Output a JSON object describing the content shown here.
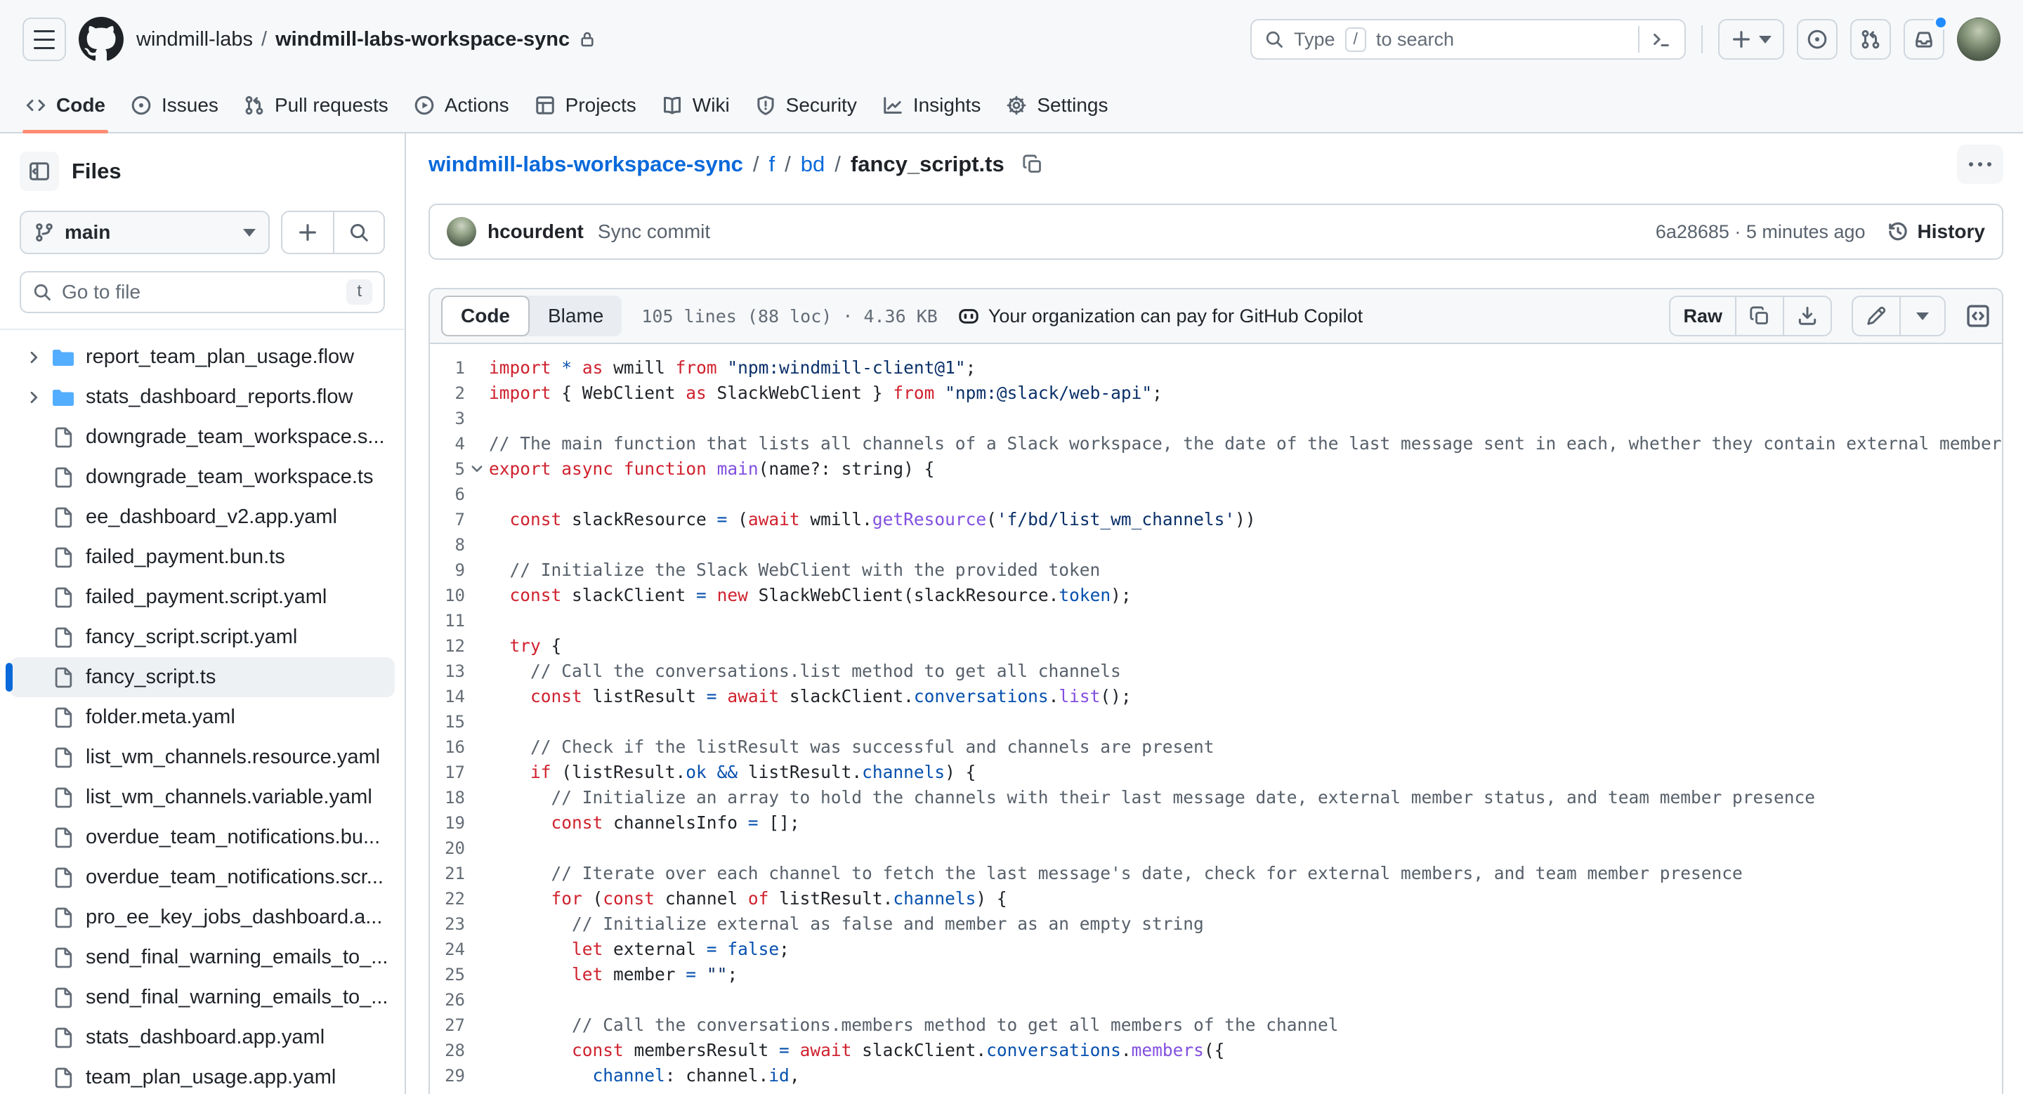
{
  "header": {
    "owner": "windmill-labs",
    "separator": "/",
    "repo": "windmill-labs-workspace-sync",
    "search": {
      "prefix": "Type",
      "kbd": "/",
      "suffix": "to search"
    }
  },
  "nav": {
    "tabs": [
      {
        "label": "Code",
        "active": true
      },
      {
        "label": "Issues",
        "active": false
      },
      {
        "label": "Pull requests",
        "active": false
      },
      {
        "label": "Actions",
        "active": false
      },
      {
        "label": "Projects",
        "active": false
      },
      {
        "label": "Wiki",
        "active": false
      },
      {
        "label": "Security",
        "active": false
      },
      {
        "label": "Insights",
        "active": false
      },
      {
        "label": "Settings",
        "active": false
      }
    ]
  },
  "sidebar": {
    "title": "Files",
    "branch": "main",
    "goto_placeholder": "Go to file",
    "goto_kbd": "t",
    "tree": [
      {
        "name": "report_team_plan_usage.flow",
        "type": "folder",
        "selected": false
      },
      {
        "name": "stats_dashboard_reports.flow",
        "type": "folder",
        "selected": false
      },
      {
        "name": "downgrade_team_workspace.s...",
        "type": "file",
        "selected": false
      },
      {
        "name": "downgrade_team_workspace.ts",
        "type": "file",
        "selected": false
      },
      {
        "name": "ee_dashboard_v2.app.yaml",
        "type": "file",
        "selected": false
      },
      {
        "name": "failed_payment.bun.ts",
        "type": "file",
        "selected": false
      },
      {
        "name": "failed_payment.script.yaml",
        "type": "file",
        "selected": false
      },
      {
        "name": "fancy_script.script.yaml",
        "type": "file",
        "selected": false
      },
      {
        "name": "fancy_script.ts",
        "type": "file",
        "selected": true
      },
      {
        "name": "folder.meta.yaml",
        "type": "file",
        "selected": false
      },
      {
        "name": "list_wm_channels.resource.yaml",
        "type": "file",
        "selected": false
      },
      {
        "name": "list_wm_channels.variable.yaml",
        "type": "file",
        "selected": false
      },
      {
        "name": "overdue_team_notifications.bu...",
        "type": "file",
        "selected": false
      },
      {
        "name": "overdue_team_notifications.scr...",
        "type": "file",
        "selected": false
      },
      {
        "name": "pro_ee_key_jobs_dashboard.a...",
        "type": "file",
        "selected": false
      },
      {
        "name": "send_final_warning_emails_to_...",
        "type": "file",
        "selected": false
      },
      {
        "name": "send_final_warning_emails_to_...",
        "type": "file",
        "selected": false
      },
      {
        "name": "stats_dashboard.app.yaml",
        "type": "file",
        "selected": false
      },
      {
        "name": "team_plan_usage.app.yaml",
        "type": "file",
        "selected": false
      }
    ]
  },
  "main": {
    "breadcrumb": {
      "repo": "windmill-labs-workspace-sync",
      "sep": "/",
      "dir1": "f",
      "dir2": "bd",
      "file": "fancy_script.ts"
    },
    "commit": {
      "author": "hcourdent",
      "message": "Sync commit",
      "meta": "6a28685 · 5 minutes ago",
      "history_label": "History"
    },
    "toolbar": {
      "code_tab": "Code",
      "blame_tab": "Blame",
      "file_info": "105 lines (88 loc) · 4.36 KB",
      "copilot_banner": "Your organization can pay for GitHub Copilot",
      "raw_label": "Raw"
    }
  },
  "code": {
    "accent_colors": {
      "keyword": "#cf222e",
      "constant": "#0550ae",
      "entity": "#8250df",
      "string": "#0a3069",
      "comment": "#57606a"
    },
    "lines": [
      {
        "n": 1,
        "t": [
          [
            "k",
            "import"
          ],
          [
            "p",
            " "
          ],
          [
            "b",
            "*"
          ],
          [
            "p",
            " "
          ],
          [
            "k",
            "as"
          ],
          [
            "p",
            " wmill "
          ],
          [
            "k",
            "from"
          ],
          [
            "p",
            " "
          ],
          [
            "s",
            "\"npm:windmill-client@1\""
          ],
          [
            "p",
            ";"
          ]
        ]
      },
      {
        "n": 2,
        "t": [
          [
            "k",
            "import"
          ],
          [
            "p",
            " { WebClient "
          ],
          [
            "k",
            "as"
          ],
          [
            "p",
            " SlackWebClient } "
          ],
          [
            "k",
            "from"
          ],
          [
            "p",
            " "
          ],
          [
            "s",
            "\"npm:@slack/web-api\""
          ],
          [
            "p",
            ";"
          ]
        ]
      },
      {
        "n": 3,
        "t": []
      },
      {
        "n": 4,
        "t": [
          [
            "c",
            "// The main function that lists all channels of a Slack workspace, the date of the last message sent in each, whether they contain external members, and if a sp"
          ]
        ]
      },
      {
        "n": 5,
        "fold": true,
        "t": [
          [
            "k",
            "export"
          ],
          [
            "p",
            " "
          ],
          [
            "k",
            "async"
          ],
          [
            "p",
            " "
          ],
          [
            "k",
            "function"
          ],
          [
            "p",
            " "
          ],
          [
            "e",
            "main"
          ],
          [
            "p",
            "(name?: string) {"
          ]
        ]
      },
      {
        "n": 6,
        "t": []
      },
      {
        "n": 7,
        "t": [
          [
            "p",
            "  "
          ],
          [
            "k",
            "const"
          ],
          [
            "p",
            " slackResource "
          ],
          [
            "b",
            "="
          ],
          [
            "p",
            " ("
          ],
          [
            "k",
            "await"
          ],
          [
            "p",
            " wmill."
          ],
          [
            "e",
            "getResource"
          ],
          [
            "p",
            "("
          ],
          [
            "s",
            "'f/bd/list_wm_channels'"
          ],
          [
            "p",
            "))"
          ]
        ]
      },
      {
        "n": 8,
        "t": []
      },
      {
        "n": 9,
        "t": [
          [
            "p",
            "  "
          ],
          [
            "c",
            "// Initialize the Slack WebClient with the provided token"
          ]
        ]
      },
      {
        "n": 10,
        "t": [
          [
            "p",
            "  "
          ],
          [
            "k",
            "const"
          ],
          [
            "p",
            " slackClient "
          ],
          [
            "b",
            "="
          ],
          [
            "p",
            " "
          ],
          [
            "k",
            "new"
          ],
          [
            "p",
            " SlackWebClient(slackResource."
          ],
          [
            "b",
            "token"
          ],
          [
            "p",
            ");"
          ]
        ]
      },
      {
        "n": 11,
        "t": []
      },
      {
        "n": 12,
        "t": [
          [
            "p",
            "  "
          ],
          [
            "k",
            "try"
          ],
          [
            "p",
            " {"
          ]
        ]
      },
      {
        "n": 13,
        "t": [
          [
            "p",
            "    "
          ],
          [
            "c",
            "// Call the conversations.list method to get all channels"
          ]
        ]
      },
      {
        "n": 14,
        "t": [
          [
            "p",
            "    "
          ],
          [
            "k",
            "const"
          ],
          [
            "p",
            " listResult "
          ],
          [
            "b",
            "="
          ],
          [
            "p",
            " "
          ],
          [
            "k",
            "await"
          ],
          [
            "p",
            " slackClient."
          ],
          [
            "b",
            "conversations"
          ],
          [
            "p",
            "."
          ],
          [
            "e",
            "list"
          ],
          [
            "p",
            "();"
          ]
        ]
      },
      {
        "n": 15,
        "t": []
      },
      {
        "n": 16,
        "t": [
          [
            "p",
            "    "
          ],
          [
            "c",
            "// Check if the listResult was successful and channels are present"
          ]
        ]
      },
      {
        "n": 17,
        "t": [
          [
            "p",
            "    "
          ],
          [
            "k",
            "if"
          ],
          [
            "p",
            " (listResult."
          ],
          [
            "b",
            "ok"
          ],
          [
            "p",
            " "
          ],
          [
            "b",
            "&&"
          ],
          [
            "p",
            " listResult."
          ],
          [
            "b",
            "channels"
          ],
          [
            "p",
            ") {"
          ]
        ]
      },
      {
        "n": 18,
        "t": [
          [
            "p",
            "      "
          ],
          [
            "c",
            "// Initialize an array to hold the channels with their last message date, external member status, and team member presence"
          ]
        ]
      },
      {
        "n": 19,
        "t": [
          [
            "p",
            "      "
          ],
          [
            "k",
            "const"
          ],
          [
            "p",
            " channelsInfo "
          ],
          [
            "b",
            "="
          ],
          [
            "p",
            " [];"
          ]
        ]
      },
      {
        "n": 20,
        "t": []
      },
      {
        "n": 21,
        "t": [
          [
            "p",
            "      "
          ],
          [
            "c",
            "// Iterate over each channel to fetch the last message's date, check for external members, and team member presence"
          ]
        ]
      },
      {
        "n": 22,
        "t": [
          [
            "p",
            "      "
          ],
          [
            "k",
            "for"
          ],
          [
            "p",
            " ("
          ],
          [
            "k",
            "const"
          ],
          [
            "p",
            " channel "
          ],
          [
            "k",
            "of"
          ],
          [
            "p",
            " listResult."
          ],
          [
            "b",
            "channels"
          ],
          [
            "p",
            ") {"
          ]
        ]
      },
      {
        "n": 23,
        "t": [
          [
            "p",
            "        "
          ],
          [
            "c",
            "// Initialize external as false and member as an empty string"
          ]
        ]
      },
      {
        "n": 24,
        "t": [
          [
            "p",
            "        "
          ],
          [
            "k",
            "let"
          ],
          [
            "p",
            " external "
          ],
          [
            "b",
            "="
          ],
          [
            "p",
            " "
          ],
          [
            "b",
            "false"
          ],
          [
            "p",
            ";"
          ]
        ]
      },
      {
        "n": 25,
        "t": [
          [
            "p",
            "        "
          ],
          [
            "k",
            "let"
          ],
          [
            "p",
            " member "
          ],
          [
            "b",
            "="
          ],
          [
            "p",
            " "
          ],
          [
            "s",
            "\"\""
          ],
          [
            "p",
            ";"
          ]
        ]
      },
      {
        "n": 26,
        "t": []
      },
      {
        "n": 27,
        "t": [
          [
            "p",
            "        "
          ],
          [
            "c",
            "// Call the conversations.members method to get all members of the channel"
          ]
        ]
      },
      {
        "n": 28,
        "t": [
          [
            "p",
            "        "
          ],
          [
            "k",
            "const"
          ],
          [
            "p",
            " membersResult "
          ],
          [
            "b",
            "="
          ],
          [
            "p",
            " "
          ],
          [
            "k",
            "await"
          ],
          [
            "p",
            " slackClient."
          ],
          [
            "b",
            "conversations"
          ],
          [
            "p",
            "."
          ],
          [
            "e",
            "members"
          ],
          [
            "p",
            "({"
          ]
        ]
      },
      {
        "n": 29,
        "t": [
          [
            "p",
            "          "
          ],
          [
            "b",
            "channel"
          ],
          [
            "p",
            ": channel."
          ],
          [
            "b",
            "id"
          ],
          [
            "p",
            ","
          ]
        ]
      }
    ]
  }
}
